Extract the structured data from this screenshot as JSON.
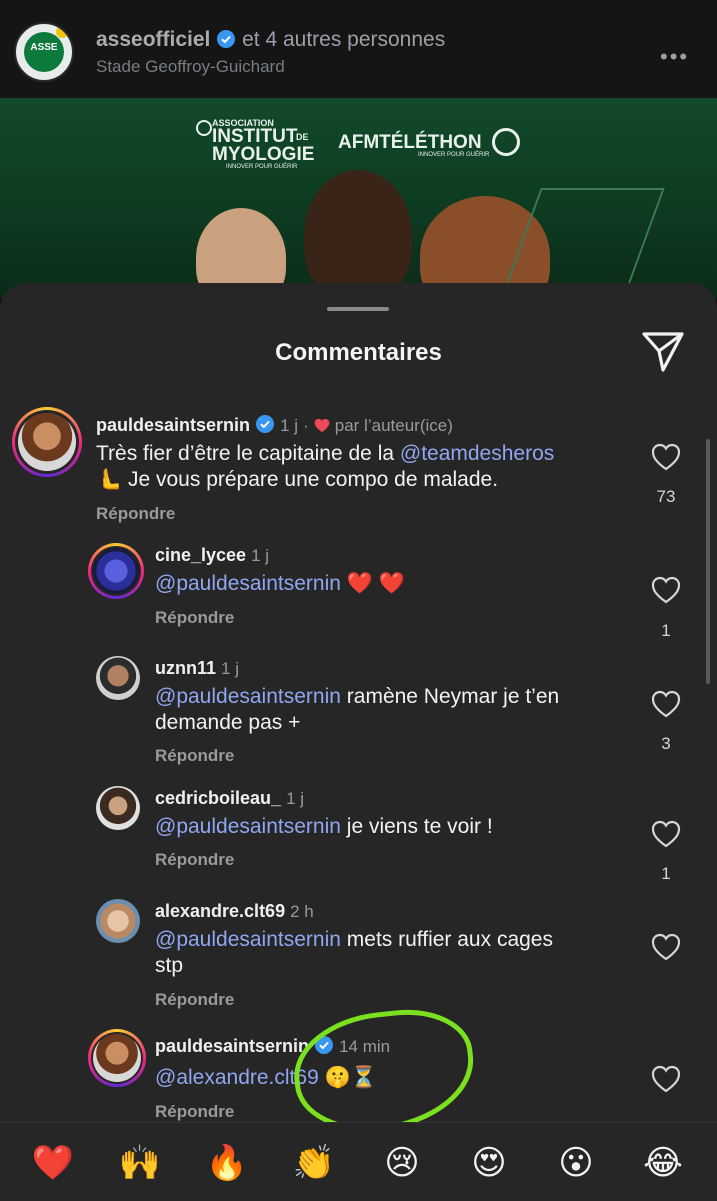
{
  "header": {
    "account": "asseofficiel",
    "others": "et 4 autres personnes",
    "location": "Stade Geoffroy-Guichard",
    "avatar_text": "ASSE",
    "more": "•••"
  },
  "post": {
    "logo1_line1": "ASSOCIATION",
    "logo1_line2": "INSTITUT",
    "logo1_de": "DE",
    "logo1_line3": "MYOLOGIE",
    "logo1_tag": "INNOVER POUR GUÉRIR",
    "logo2": "AFMTÉLÉTHON",
    "logo2_tag": "INNOVER POUR GUÉRIR"
  },
  "sheet": {
    "title": "Commentaires"
  },
  "comments": [
    {
      "user": "pauldesaintsernin",
      "time": "1 j",
      "dot": "·",
      "liked_by_author": "par l’auteur(ice)",
      "mention": "@teamdesheros",
      "text_before": "Très fier d’être le capitaine de la ",
      "text_line2": "🫷 Je vous prépare une compo de malade.",
      "reply": "Répondre",
      "likes": "73"
    },
    {
      "user": "cine_lycee",
      "time": "1 j",
      "mention": "@pauldesaintsernin",
      "text": " ❤️ ❤️",
      "reply": "Répondre",
      "likes": "1"
    },
    {
      "user": "uznn11",
      "time": "1 j",
      "mention": "@pauldesaintsernin",
      "text": " ramène Neymar je t’en",
      "text_line2": "demande pas +",
      "reply": "Répondre",
      "likes": "3"
    },
    {
      "user": "cedricboileau_",
      "time": "1 j",
      "mention": "@pauldesaintsernin",
      "text": " je viens te voir !",
      "reply": "Répondre",
      "likes": "1"
    },
    {
      "user": "alexandre.clt69",
      "time": "2 h",
      "mention": "@pauldesaintsernin",
      "text": " mets ruffier aux cages",
      "text_line2": "stp",
      "reply": "Répondre"
    },
    {
      "user": "pauldesaintsernin",
      "time": "14 min",
      "mention": "@alexandre.clt69",
      "text": " 🤫⏳",
      "reply": "Répondre"
    }
  ],
  "emoji_bar": [
    "❤️",
    "🙌",
    "🔥",
    "👏",
    "😢",
    "😍",
    "😮",
    "😂"
  ],
  "colors": {
    "background": "#121212",
    "sheet": "#262626",
    "mention": "#8fa7f0",
    "verified": "#3897f0",
    "highlight": "#7be020",
    "liked_heart": "#ed4956"
  }
}
